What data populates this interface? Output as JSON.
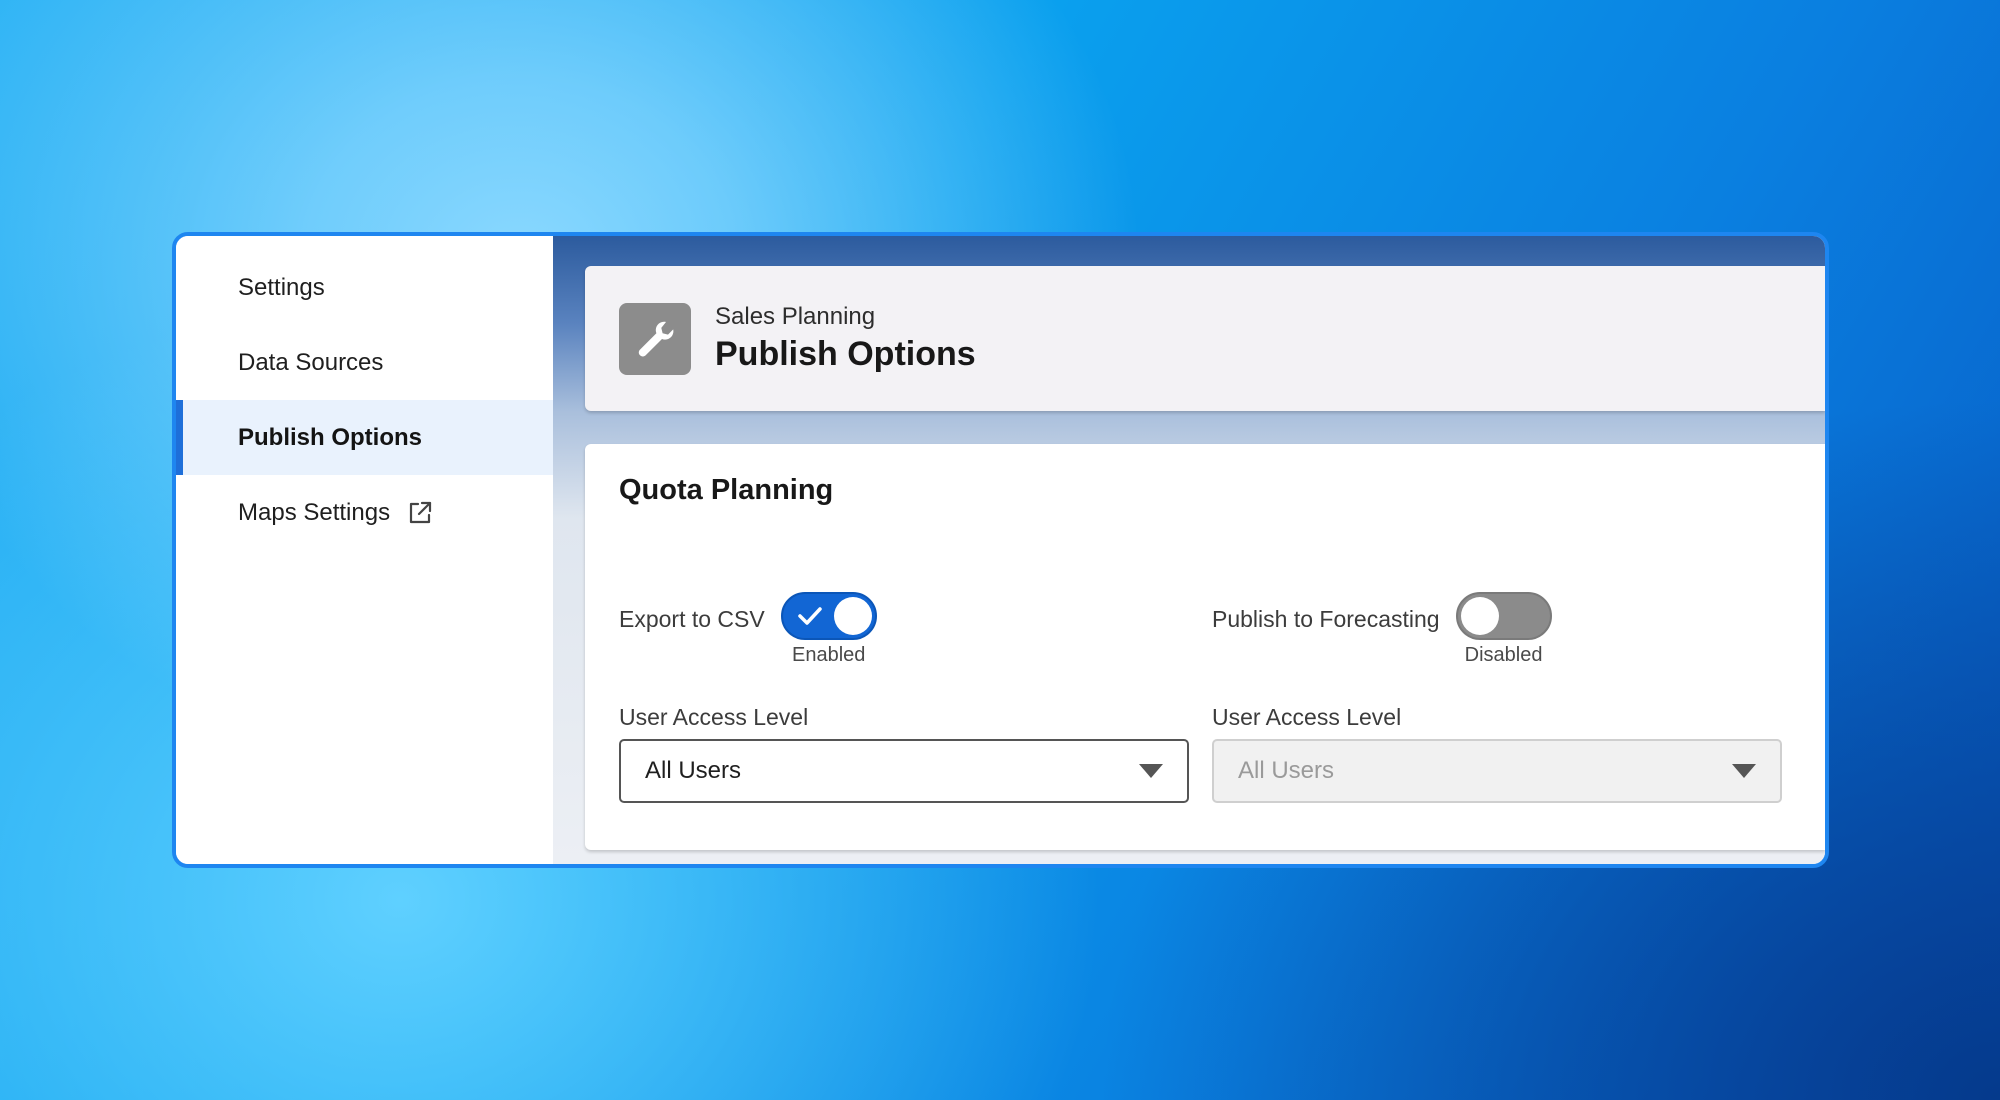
{
  "sidebar": {
    "items": [
      {
        "label": "Settings",
        "active": false
      },
      {
        "label": "Data Sources",
        "active": false
      },
      {
        "label": "Publish Options",
        "active": true
      },
      {
        "label": "Maps Settings",
        "active": false,
        "icon": "external-link-icon"
      }
    ]
  },
  "header": {
    "icon": "wrench-icon",
    "eyebrow": "Sales Planning",
    "title": "Publish Options"
  },
  "section": {
    "title": "Quota Planning",
    "left": {
      "toggle_label": "Export to CSV",
      "toggle_state": true,
      "toggle_status": "Enabled",
      "field_label": "User Access Level",
      "field_value": "All Users",
      "field_enabled": true
    },
    "right": {
      "toggle_label": "Publish to Forecasting",
      "toggle_state": false,
      "toggle_status": "Disabled",
      "field_label": "User Access Level",
      "field_value": "All Users",
      "field_enabled": false
    }
  },
  "colors": {
    "accent": "#1266d4",
    "window_border": "#1e86f0",
    "active_nav_bg": "#e9f2fd"
  }
}
